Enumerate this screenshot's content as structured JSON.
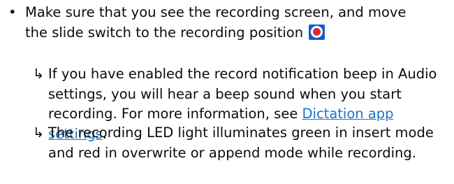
{
  "step": {
    "bullet": "•",
    "text": "Make sure that you see the recording screen, and move the slide switch to the recording position",
    "icon": "record-icon"
  },
  "results": [
    {
      "arrow": "↳",
      "text_before": "If you have enabled the record notification beep in Audio settings, you will hear a beep sound when you start recording. For more information, see ",
      "link": "Dictation app settings",
      "text_after": "."
    },
    {
      "arrow": "↳",
      "text": "The recording LED light illuminates green in insert mode and red in overwrite or append mode while recording."
    }
  ],
  "colors": {
    "text": "#0b0b0b",
    "link": "#1a73c8",
    "icon_background": "#0b5ed7",
    "icon_record_dot": "#e0262e"
  }
}
